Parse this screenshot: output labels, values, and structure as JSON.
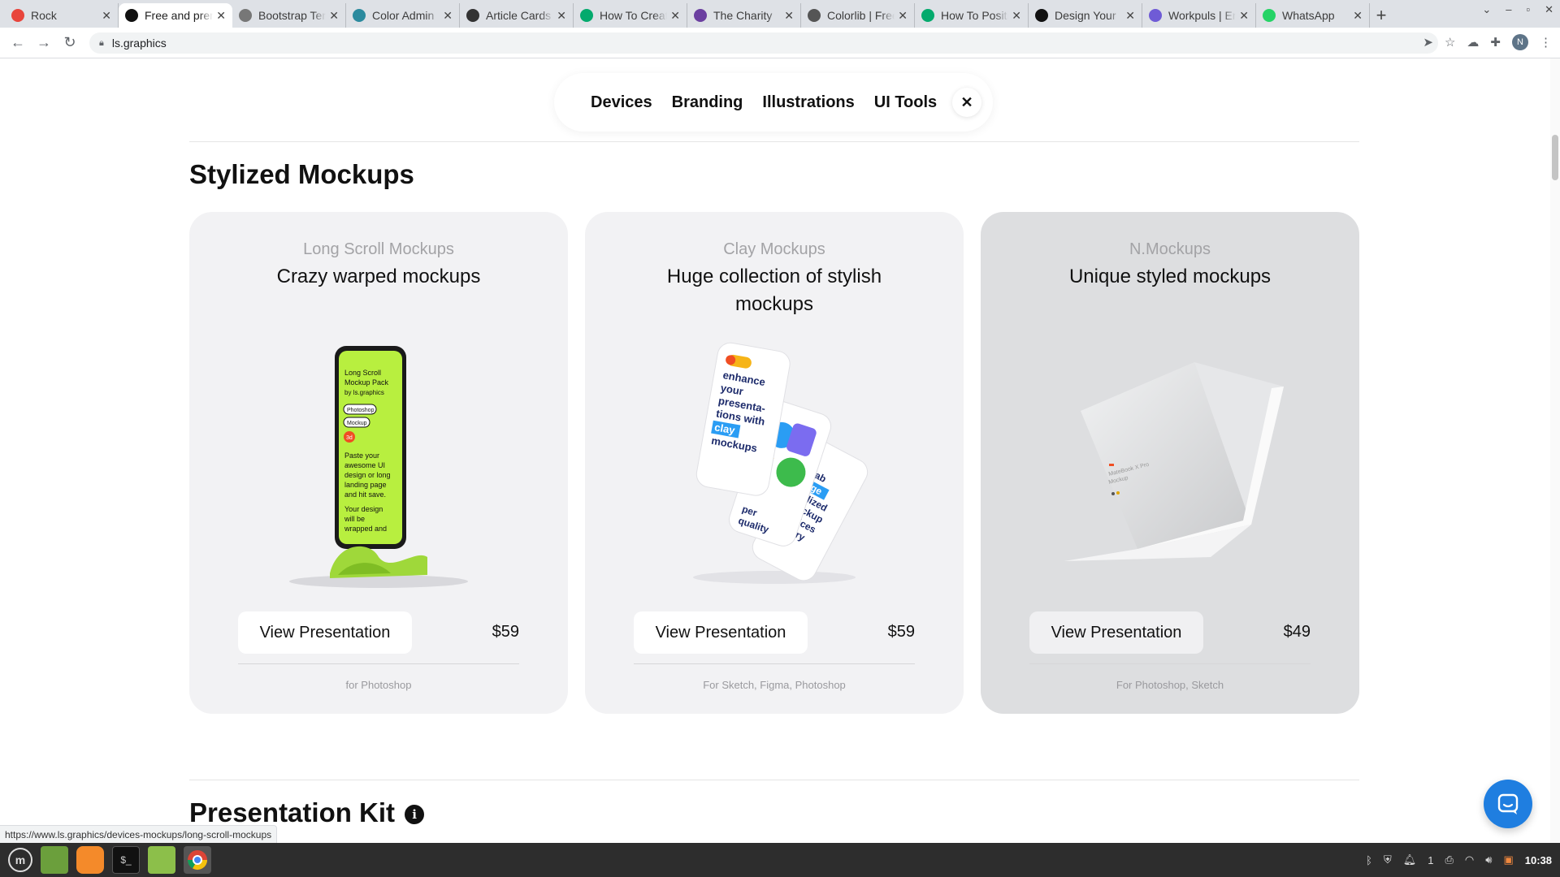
{
  "browser": {
    "tabs": [
      {
        "title": "Rock",
        "color": "#e8453c"
      },
      {
        "title": "Free and premium",
        "color": "#111111",
        "active": true
      },
      {
        "title": "Bootstrap Templates",
        "color": "#777777"
      },
      {
        "title": "Color Admin",
        "color": "#2b8a9e"
      },
      {
        "title": "Article Cards",
        "color": "#333333"
      },
      {
        "title": "How To Create",
        "color": "#04aa6d"
      },
      {
        "title": "The Charity",
        "color": "#6b3fa0"
      },
      {
        "title": "Colorlib | Free",
        "color": "#555555"
      },
      {
        "title": "How To Position",
        "color": "#04aa6d"
      },
      {
        "title": "Design Your",
        "color": "#111111"
      },
      {
        "title": "Workpuls | Em",
        "color": "#6f5bd6"
      },
      {
        "title": "WhatsApp",
        "color": "#25d366"
      }
    ],
    "close_symbol": "✕",
    "new_tab_symbol": "+",
    "url": "ls.graphics",
    "status_url": "https://www.ls.graphics/devices-mockups/long-scroll-mockups",
    "avatar_letter": "N"
  },
  "subnav": {
    "items": [
      "Devices",
      "Branding",
      "Illustrations",
      "UI Tools"
    ],
    "close_symbol": "✕"
  },
  "sections": {
    "stylized_title": "Stylized Mockups",
    "presentation_title": "Presentation Kit",
    "info_symbol": "i"
  },
  "cards": [
    {
      "category": "Long Scroll Mockups",
      "description": "Crazy warped mockups",
      "button": "View Presentation",
      "price": "$59",
      "for": "for Photoshop",
      "bg": "#f2f2f4",
      "phone_text": [
        "Long Scroll",
        "Mockup Pack",
        "by ls.graphics",
        "Photoshop",
        "Mockup",
        "3d",
        "Paste your",
        "awesome UI",
        "design or long",
        "landing page",
        "and hit save.",
        "Your design",
        "will be",
        "wrapped and"
      ]
    },
    {
      "category": "Clay Mockups",
      "description": "Huge collection of stylish mockups",
      "button": "View Presentation",
      "price": "$59",
      "for": "For Sketch, Figma, Photoshop",
      "bg": "#f2f2f4",
      "phone_text": [
        "enhance",
        "your",
        "presenta-",
        "tions with",
        "clay",
        "mockups",
        "grab",
        "huge",
        "stylized",
        "mockup",
        "devices",
        "library",
        "per",
        "quality"
      ]
    },
    {
      "category": "N.Mockups",
      "description": "Unique styled mockups",
      "button": "View Presentation",
      "price": "$49",
      "for": "For Photoshop, Sketch",
      "bg": "#dddee0",
      "screen_text": [
        "MateBook X Pro",
        "Mockup"
      ]
    }
  ],
  "taskbar": {
    "clock": "10:38",
    "workspace": "1"
  }
}
